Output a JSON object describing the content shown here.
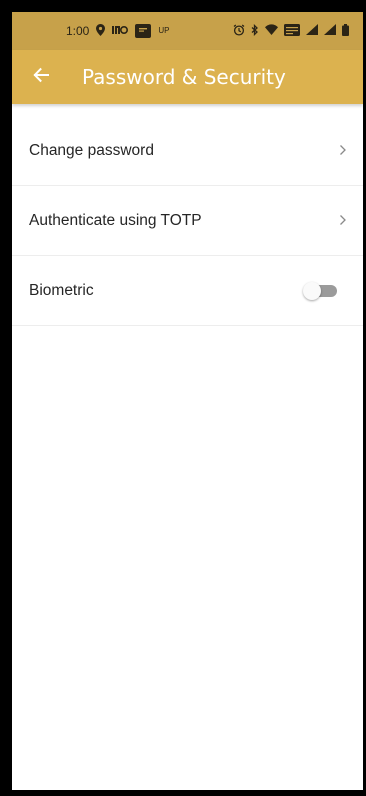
{
  "status_bar": {
    "time": "1:00",
    "icons_left": [
      "location-icon",
      "indo-icon",
      "pay-icon",
      "up-icon"
    ],
    "up_label": "UP",
    "right_icons": [
      "alarm-icon",
      "bluetooth-icon",
      "wifi-icon",
      "volte-icon",
      "signal-icon",
      "signal-icon",
      "battery-icon"
    ]
  },
  "app_bar": {
    "title": "Password & Security",
    "back_icon": "arrow-left-icon"
  },
  "settings": {
    "items": [
      {
        "label": "Change password",
        "control": "chevron"
      },
      {
        "label": "Authenticate using TOTP",
        "control": "chevron"
      },
      {
        "label": "Biometric",
        "control": "toggle",
        "enabled": false
      }
    ]
  },
  "colors": {
    "app_bar": "#dcb24f",
    "status_bar": "#c7a14a",
    "text": "#262626",
    "divider": "#ededed",
    "toggle_track_off": "#9b9b9b"
  }
}
